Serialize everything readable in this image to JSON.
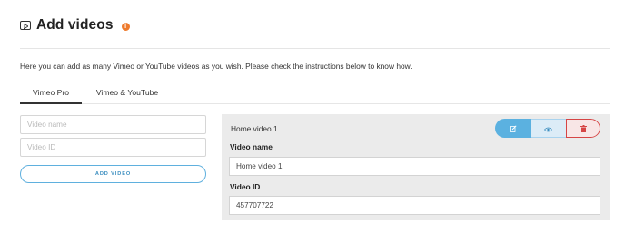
{
  "header": {
    "title": "Add videos",
    "info_icon": "i"
  },
  "intro": "Here you can add as many Vimeo or YouTube videos as you wish. Please check the instructions below to know how.",
  "tabs": [
    {
      "label": "Vimeo Pro",
      "active": true
    },
    {
      "label": "Vimeo & YouTube",
      "active": false
    }
  ],
  "form": {
    "video_name_placeholder": "Video name",
    "video_id_placeholder": "Video ID",
    "add_button": "ADD VIDEO"
  },
  "video_card": {
    "title": "Home video 1",
    "name_label": "Video name",
    "name_value": "Home video 1",
    "id_label": "Video ID",
    "id_value": "457707722",
    "actions": [
      "edit-icon",
      "eye-icon",
      "trash-icon"
    ]
  },
  "colors": {
    "accent": "#5bb1e0",
    "danger": "#d64545",
    "info": "#ee7a2c"
  }
}
